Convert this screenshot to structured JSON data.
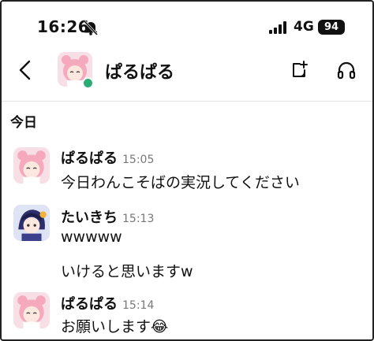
{
  "status_bar": {
    "time": "16:26",
    "network": "4G",
    "battery": "94"
  },
  "nav": {
    "title": "ぱるぱる"
  },
  "date_divider": "今日",
  "messages": [
    {
      "author": "ぱるぱる",
      "time": "15:05",
      "lines": [
        "今日わんこそばの実況してください"
      ]
    },
    {
      "author": "たいきち",
      "time": "15:13",
      "lines": [
        "wwwww",
        "いけると思いますw"
      ]
    },
    {
      "author": "ぱるぱる",
      "time": "15:14",
      "lines": [
        "お願いします😂"
      ]
    }
  ],
  "colors": {
    "presence": "#2bac76",
    "timestamp": "#777777",
    "avatar_pink": "#f6c6d4",
    "avatar_dark": "#2c2f6b"
  }
}
